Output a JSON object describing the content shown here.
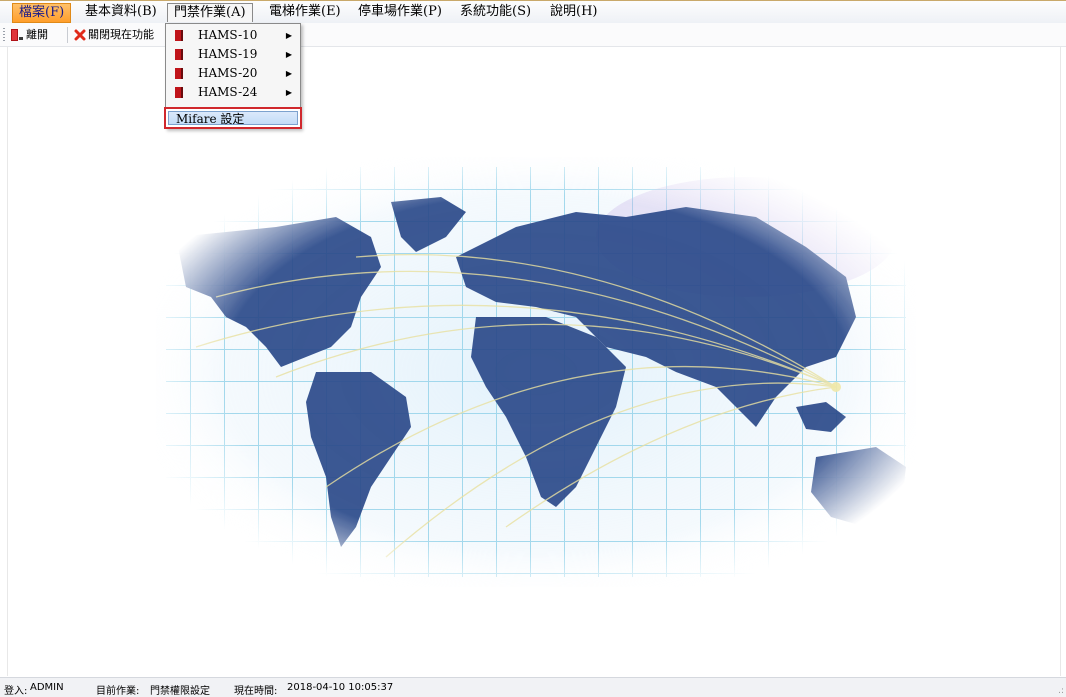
{
  "menubar": {
    "items": [
      "檔案(F)",
      "基本資料(B)",
      "門禁作業(A)",
      "電梯作業(E)",
      "停車場作業(P)",
      "系統功能(S)",
      "說明(H)"
    ]
  },
  "toolbar": {
    "exit_label": "離開",
    "close_current_label": "關閉現在功能"
  },
  "dropdown": {
    "items": [
      {
        "label": "HAMS-10",
        "has_submenu": true
      },
      {
        "label": "HAMS-19",
        "has_submenu": true
      },
      {
        "label": "HAMS-20",
        "has_submenu": true
      },
      {
        "label": "HAMS-24",
        "has_submenu": true
      }
    ],
    "highlighted_label": "Mifare 設定",
    "submenu_arrow": "▶"
  },
  "status": {
    "login_label": "登入:",
    "login_value": "ADMIN",
    "current_label": "目前作業:",
    "current_value": "門禁權限設定",
    "time_label": "現在時間:",
    "time_value": "2018-04-10 10:05:37"
  },
  "colors": {
    "file_menu_active": "#ff9e2b",
    "highlight_border": "#d0282d",
    "map_land": "#2b4a8a",
    "map_grid": "#8fd0e8"
  },
  "icons": {
    "exit": "exit-door-icon",
    "close": "red-x-icon",
    "submenu_item": "red-book-icon",
    "resize": "resize-grip-icon"
  }
}
